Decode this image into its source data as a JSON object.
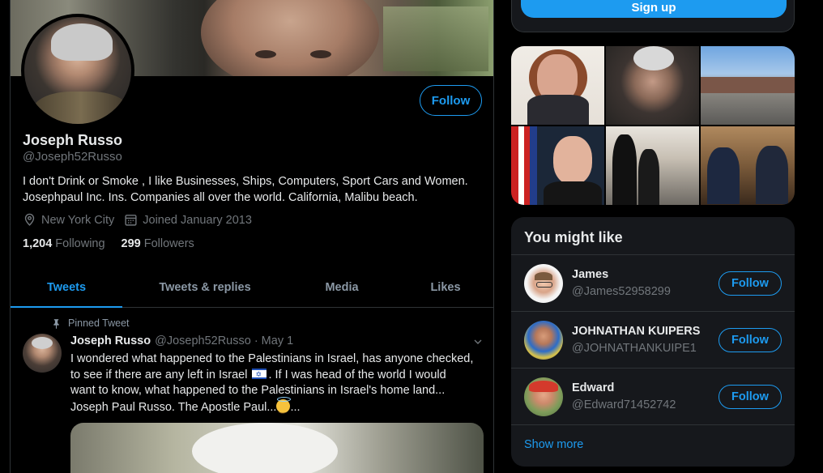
{
  "profile": {
    "name": "Joseph Russo",
    "handle": "@Joseph52Russo",
    "follow_label": "Follow",
    "bio_line1": "I don't Drink or Smoke , I like Businesses, Ships, Computers, Sport Cars and Women.",
    "bio_line2": "Josephpaul Inc. Ins. Companies all over the world. California, Malibu beach.",
    "location": "New York City",
    "joined": "Joined January 2013",
    "following_count": "1,204",
    "following_label": "Following",
    "followers_count": "299",
    "followers_label": "Followers"
  },
  "tabs": [
    {
      "label": "Tweets",
      "active": true
    },
    {
      "label": "Tweets & replies",
      "active": false
    },
    {
      "label": "Media",
      "active": false
    },
    {
      "label": "Likes",
      "active": false
    }
  ],
  "pinned_tweet": {
    "pinned_label": "Pinned Tweet",
    "author_name": "Joseph Russo",
    "author_handle": "@Joseph52Russo",
    "separator": "·",
    "date": "May 1",
    "text_line1": "I wondered what happened to the Palestinians in Israel, has anyone checked,",
    "text_line2a": "to see if there are any left in Israel",
    "text_line2b": ". If I was head of the world I would",
    "text_line3": "want to know, what happened to the Palestinians in Israel's home land...",
    "text_line4a": "Joseph Paul Russo. The Apostle Paul...",
    "text_line4b": "..."
  },
  "signup": {
    "label": "Sign up"
  },
  "who_to_follow": {
    "title": "You might like",
    "items": [
      {
        "name": "James",
        "handle": "@James52958299",
        "button": "Follow"
      },
      {
        "name": "JOHNATHAN KUIPERS",
        "handle": "@JOHNATHANKUIPE1",
        "button": "Follow"
      },
      {
        "name": "Edward",
        "handle": "@Edward71452742",
        "button": "Follow"
      }
    ],
    "show_more": "Show more"
  },
  "colors": {
    "accent": "#1d9bf0",
    "background": "#000000",
    "card": "#16181c",
    "text_primary": "#e7e9ea",
    "text_secondary": "#71767b"
  },
  "icons": [
    "location-pin-icon",
    "calendar-icon",
    "pin-icon",
    "chevron-down-icon",
    "israel-flag-emoji",
    "smiling-face-with-halo-emoji"
  ]
}
